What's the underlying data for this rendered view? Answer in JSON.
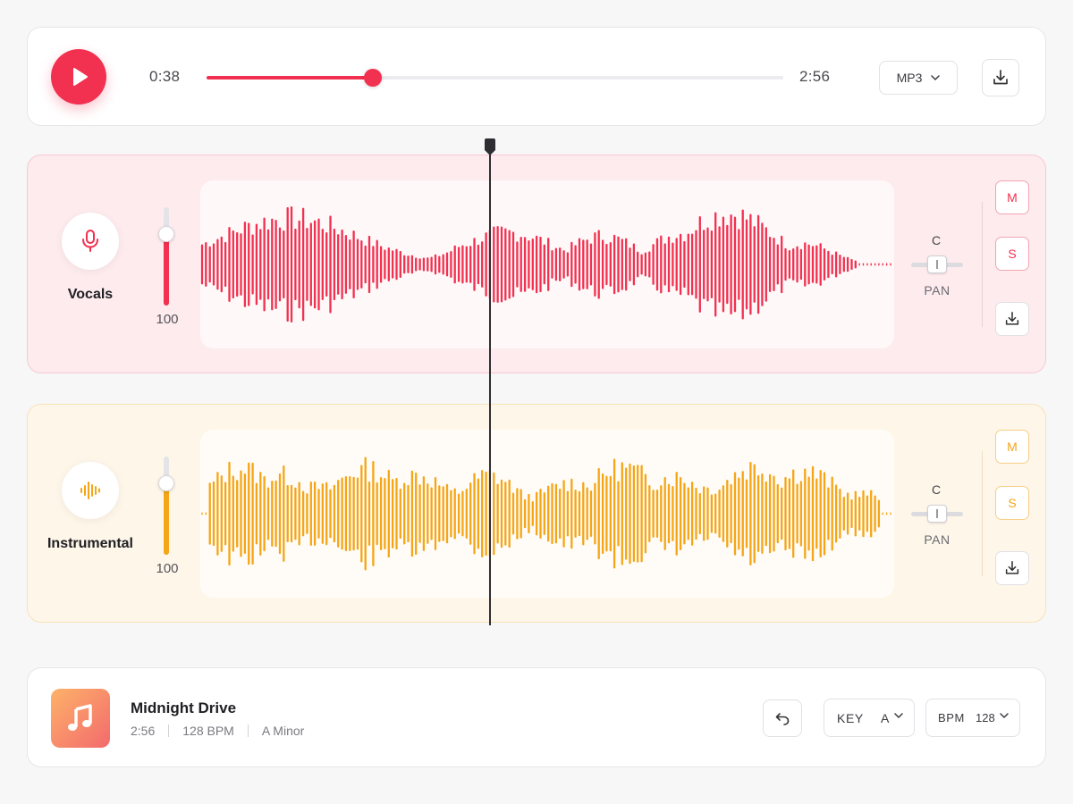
{
  "transport": {
    "current_time": "0:38",
    "total_time": "2:56",
    "progress": 0.2879,
    "format": "MP3",
    "accent": "#f2304f",
    "icons": {
      "play": "play-icon",
      "download": "download-icon",
      "format_chevron": "chevron-down-icon"
    }
  },
  "tracks": [
    {
      "name": "Vocals",
      "icon": "microphone-icon",
      "volume": "100",
      "volume_level": 0.73,
      "pan_value": "C",
      "pan_label": "PAN",
      "pan_position": 0.5,
      "mute_label": "M",
      "solo_label": "S",
      "color": "#f2304f"
    },
    {
      "name": "Instrumental",
      "icon": "waveform-icon",
      "volume": "100",
      "volume_level": 0.73,
      "pan_value": "C",
      "pan_label": "PAN",
      "pan_position": 0.5,
      "mute_label": "M",
      "solo_label": "S",
      "color": "#f5a516"
    }
  ],
  "playhead": {
    "progress": 0.2879
  },
  "song": {
    "title": "Midnight Drive",
    "duration": "2:56",
    "bpm_text": "128 BPM",
    "key_text": "A Minor",
    "key_label": "KEY",
    "key_value": "A",
    "bpm_label": "BPM",
    "bpm_value": "128",
    "icons": {
      "art": "music-note-icon",
      "undo": "undo-icon"
    }
  }
}
